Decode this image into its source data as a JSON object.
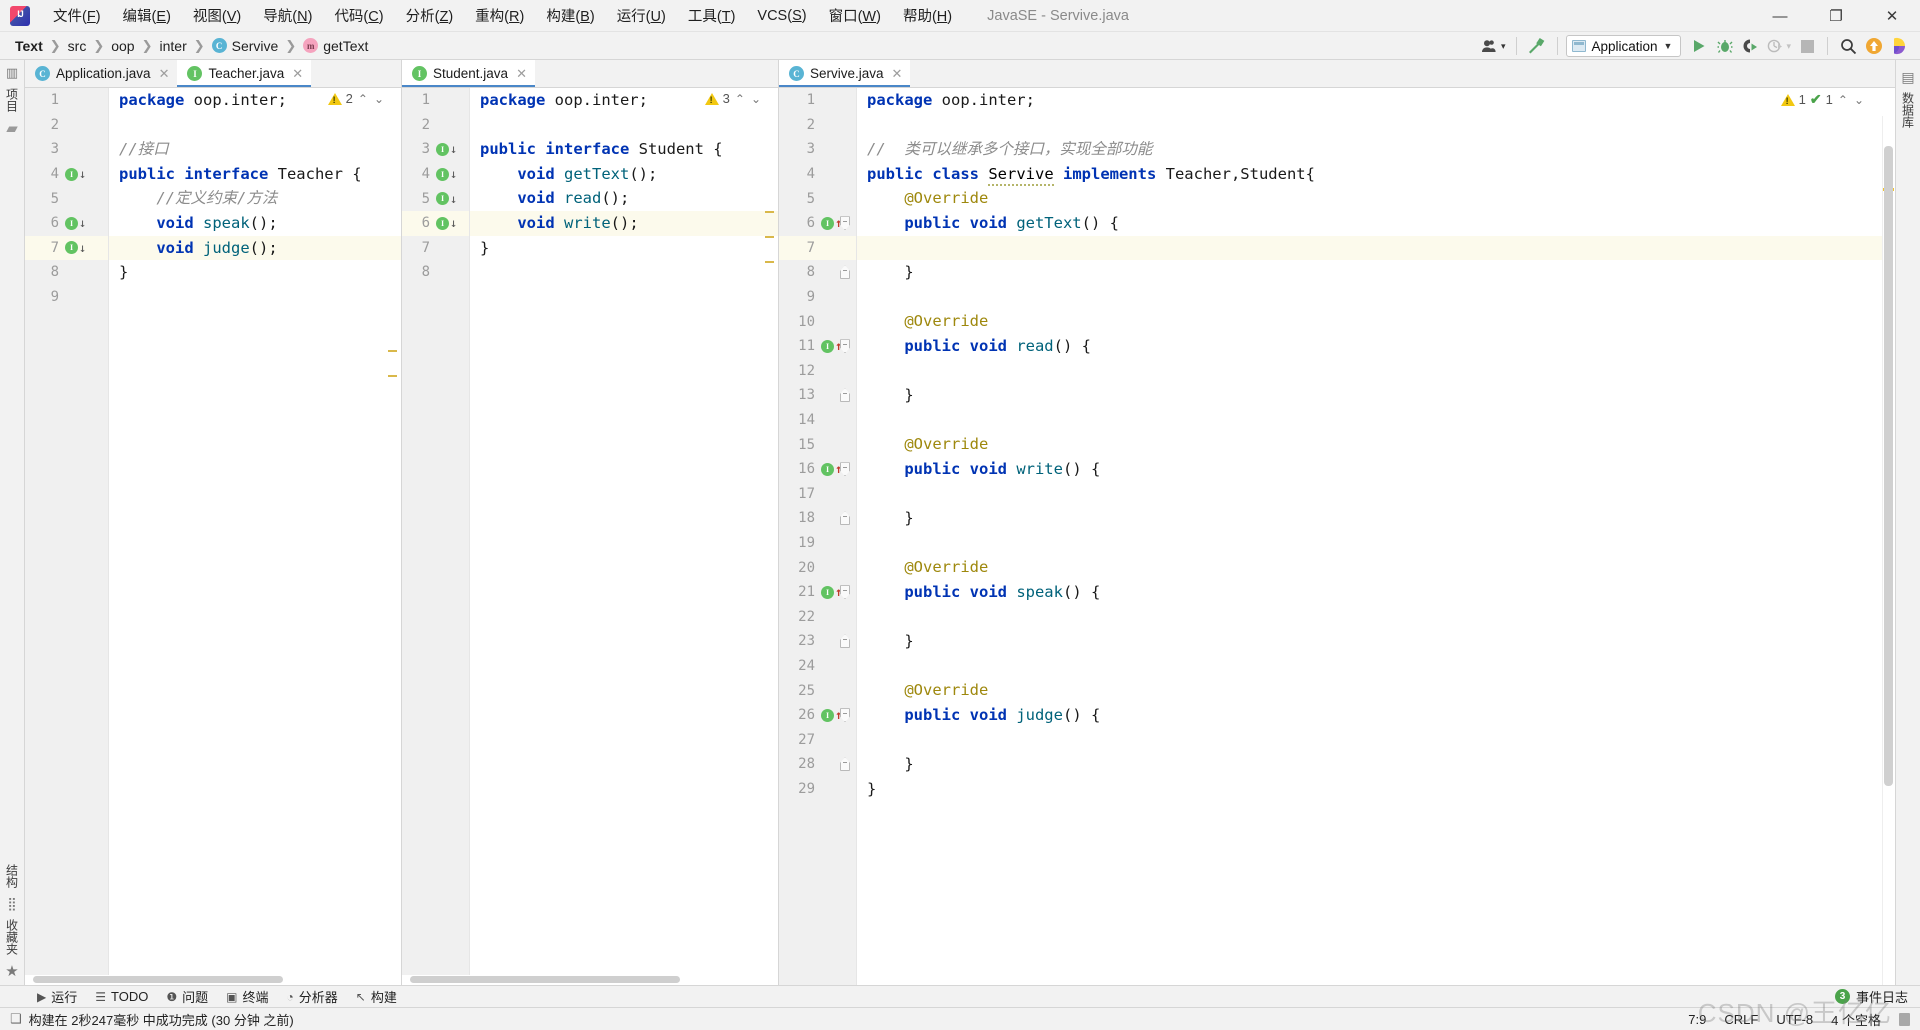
{
  "window": {
    "title": "JavaSE - Servive.java",
    "logo_icon": "intellij-logo-icon",
    "minimize_label": "—",
    "maximize_label": "❐",
    "close_label": "✕"
  },
  "menu": {
    "items": [
      {
        "label": "文件(F)",
        "name": "menu-file"
      },
      {
        "label": "编辑(E)",
        "name": "menu-edit"
      },
      {
        "label": "视图(V)",
        "name": "menu-view"
      },
      {
        "label": "导航(N)",
        "name": "menu-navigate"
      },
      {
        "label": "代码(C)",
        "name": "menu-code"
      },
      {
        "label": "分析(Z)",
        "name": "menu-analyze"
      },
      {
        "label": "重构(R)",
        "name": "menu-refactor"
      },
      {
        "label": "构建(B)",
        "name": "menu-build"
      },
      {
        "label": "运行(U)",
        "name": "menu-run"
      },
      {
        "label": "工具(T)",
        "name": "menu-tools"
      },
      {
        "label": "VCS(S)",
        "name": "menu-vcs"
      },
      {
        "label": "窗口(W)",
        "name": "menu-window"
      },
      {
        "label": "帮助(H)",
        "name": "menu-help"
      }
    ]
  },
  "breadcrumb": {
    "separator": "❯",
    "items": [
      {
        "label": "Text",
        "icon": null,
        "bold": true
      },
      {
        "label": "src",
        "icon": null,
        "bold": false
      },
      {
        "label": "oop",
        "icon": null,
        "bold": false
      },
      {
        "label": "inter",
        "icon": null,
        "bold": false
      },
      {
        "label": "Servive",
        "icon": "class-icon",
        "icon_letter": "C",
        "bold": false
      },
      {
        "label": "getText",
        "icon": "method-icon",
        "icon_letter": "m",
        "bold": false
      }
    ]
  },
  "toolbar": {
    "user_icon": "user-silhouette-icon",
    "build_icon": "hammer-icon",
    "run_config": {
      "label": "Application",
      "icon": "application-window-icon",
      "caret": "▼"
    },
    "run_icon": "run-play-icon",
    "debug_icon": "debug-bug-icon",
    "run_coverage_icon": "run-with-coverage-icon",
    "profile_icon": "profiler-icon",
    "stop_icon": "stop-square-icon",
    "search_icon": "search-magnifier-icon",
    "update_icon": "update-arrow-icon",
    "ide_icon": "ide-feature-icon",
    "caret": "▼"
  },
  "left_strip": {
    "top": [
      {
        "label": "项目",
        "name": "tool-window-project",
        "icon": "project-structure-icon"
      },
      {
        "label": "",
        "name": "tool-window-folder",
        "icon": "folder-icon"
      }
    ],
    "bottom": [
      {
        "label": "结构",
        "name": "tool-window-structure",
        "icon": "structure-blocks-icon"
      },
      {
        "label": "收藏夹",
        "name": "tool-window-favorites",
        "icon": "star-icon"
      }
    ]
  },
  "right_strip": {
    "items": [
      {
        "label": "数据库",
        "name": "tool-window-database",
        "icon": "database-icon"
      }
    ]
  },
  "editor_groups": [
    {
      "name": "editor-pane-1",
      "tabs": [
        {
          "label": "Application.java",
          "icon": "class-run-icon",
          "icon_letter": "C",
          "active": false,
          "close": "✕"
        },
        {
          "label": "Teacher.java",
          "icon": "interface-icon",
          "icon_letter": "I",
          "active": true,
          "close": "✕"
        }
      ],
      "inspection": {
        "warning_icon": "warning-triangle-icon",
        "warning_count": "2",
        "up": "⌃",
        "down": "⌄"
      },
      "lines": [
        {
          "n": "1",
          "marks": [],
          "fold": null,
          "cur": false,
          "tokens": [
            {
              "t": "package ",
              "c": "kw"
            },
            {
              "t": "oop.inter;",
              "c": "plain"
            }
          ]
        },
        {
          "n": "2",
          "marks": [],
          "fold": null,
          "cur": false,
          "tokens": []
        },
        {
          "n": "3",
          "marks": [],
          "fold": null,
          "cur": false,
          "tokens": [
            {
              "t": "//接口",
              "c": "cm"
            }
          ]
        },
        {
          "n": "4",
          "marks": [
            "impl-down"
          ],
          "fold": null,
          "cur": false,
          "tokens": [
            {
              "t": "public interface ",
              "c": "kw"
            },
            {
              "t": "Teacher",
              "c": "plain"
            },
            {
              "t": " {",
              "c": "plain"
            }
          ]
        },
        {
          "n": "5",
          "marks": [],
          "fold": null,
          "cur": false,
          "tokens": [
            {
              "t": "    //定义约束/方法",
              "c": "cm"
            }
          ]
        },
        {
          "n": "6",
          "marks": [
            "impl-down"
          ],
          "fold": null,
          "cur": false,
          "tokens": [
            {
              "t": "    ",
              "c": "plain"
            },
            {
              "t": "void ",
              "c": "kw"
            },
            {
              "t": "speak",
              "c": "mth"
            },
            {
              "t": "();",
              "c": "plain"
            }
          ]
        },
        {
          "n": "7",
          "marks": [
            "impl-down"
          ],
          "fold": null,
          "cur": true,
          "tokens": [
            {
              "t": "    ",
              "c": "plain"
            },
            {
              "t": "void ",
              "c": "kw"
            },
            {
              "t": "judge",
              "c": "mth"
            },
            {
              "t": "();",
              "c": "plain"
            }
          ]
        },
        {
          "n": "8",
          "marks": [],
          "fold": null,
          "cur": false,
          "tokens": [
            {
              "t": "}",
              "c": "plain"
            }
          ]
        },
        {
          "n": "9",
          "marks": [],
          "fold": null,
          "cur": false,
          "tokens": []
        }
      ]
    },
    {
      "name": "editor-pane-2",
      "tabs": [
        {
          "label": "Student.java",
          "icon": "interface-icon",
          "icon_letter": "I",
          "active": true,
          "close": "✕"
        }
      ],
      "inspection": {
        "warning_icon": "warning-triangle-icon",
        "warning_count": "3",
        "up": "⌃",
        "down": "⌄"
      },
      "lines": [
        {
          "n": "1",
          "marks": [],
          "fold": null,
          "cur": false,
          "tokens": [
            {
              "t": "package ",
              "c": "kw"
            },
            {
              "t": "oop.inter;",
              "c": "plain"
            }
          ]
        },
        {
          "n": "2",
          "marks": [],
          "fold": null,
          "cur": false,
          "tokens": []
        },
        {
          "n": "3",
          "marks": [
            "impl-down"
          ],
          "fold": null,
          "cur": false,
          "tokens": [
            {
              "t": "public interface ",
              "c": "kw"
            },
            {
              "t": "Student",
              "c": "plain"
            },
            {
              "t": " {",
              "c": "plain"
            }
          ]
        },
        {
          "n": "4",
          "marks": [
            "impl-down"
          ],
          "fold": null,
          "cur": false,
          "tokens": [
            {
              "t": "    ",
              "c": "plain"
            },
            {
              "t": "void ",
              "c": "kw"
            },
            {
              "t": "getText",
              "c": "mth"
            },
            {
              "t": "();",
              "c": "plain"
            }
          ]
        },
        {
          "n": "5",
          "marks": [
            "impl-down"
          ],
          "fold": null,
          "cur": false,
          "tokens": [
            {
              "t": "    ",
              "c": "plain"
            },
            {
              "t": "void ",
              "c": "kw"
            },
            {
              "t": "read",
              "c": "mth"
            },
            {
              "t": "();",
              "c": "plain"
            }
          ]
        },
        {
          "n": "6",
          "marks": [
            "impl-down"
          ],
          "fold": null,
          "cur": true,
          "tokens": [
            {
              "t": "    ",
              "c": "plain"
            },
            {
              "t": "void ",
              "c": "kw"
            },
            {
              "t": "write",
              "c": "mth"
            },
            {
              "t": "();",
              "c": "plain"
            }
          ]
        },
        {
          "n": "7",
          "marks": [],
          "fold": null,
          "cur": false,
          "tokens": [
            {
              "t": "}",
              "c": "plain"
            }
          ]
        },
        {
          "n": "8",
          "marks": [],
          "fold": null,
          "cur": false,
          "tokens": []
        }
      ]
    },
    {
      "name": "editor-pane-3",
      "tabs": [
        {
          "label": "Servive.java",
          "icon": "class-icon",
          "icon_letter": "C",
          "active": true,
          "close": "✕"
        }
      ],
      "inspection": {
        "warning_icon": "warning-triangle-icon",
        "warning_count": "1",
        "check_icon": "inspection-ok-icon",
        "check_count": "1",
        "up": "⌃",
        "down": "⌄"
      },
      "lines": [
        {
          "n": "1",
          "marks": [],
          "fold": null,
          "cur": false,
          "tokens": [
            {
              "t": "package ",
              "c": "kw"
            },
            {
              "t": "oop.inter;",
              "c": "plain"
            }
          ]
        },
        {
          "n": "2",
          "marks": [],
          "fold": null,
          "cur": false,
          "tokens": []
        },
        {
          "n": "3",
          "marks": [],
          "fold": null,
          "cur": false,
          "tokens": [
            {
              "t": "//  类可以继承多个接口，实现全部功能",
              "c": "cm"
            }
          ]
        },
        {
          "n": "4",
          "marks": [],
          "fold": null,
          "cur": false,
          "tokens": [
            {
              "t": "public class ",
              "c": "kw"
            },
            {
              "t": "Servive",
              "c": "wavy"
            },
            {
              "t": " implements ",
              "c": "kw"
            },
            {
              "t": "Teacher,Student{",
              "c": "plain"
            }
          ]
        },
        {
          "n": "5",
          "marks": [],
          "fold": null,
          "cur": false,
          "tokens": [
            {
              "t": "    @Override",
              "c": "anno"
            }
          ]
        },
        {
          "n": "6",
          "marks": [
            "impl-up"
          ],
          "fold": "open",
          "cur": false,
          "tokens": [
            {
              "t": "    ",
              "c": "plain"
            },
            {
              "t": "public void ",
              "c": "kw"
            },
            {
              "t": "getText",
              "c": "mth"
            },
            {
              "t": "() {",
              "c": "plain"
            }
          ]
        },
        {
          "n": "7",
          "marks": [],
          "fold": null,
          "cur": true,
          "tokens": []
        },
        {
          "n": "8",
          "marks": [],
          "fold": "end",
          "cur": false,
          "tokens": [
            {
              "t": "    }",
              "c": "plain"
            }
          ]
        },
        {
          "n": "9",
          "marks": [],
          "fold": null,
          "cur": false,
          "tokens": []
        },
        {
          "n": "10",
          "marks": [],
          "fold": null,
          "cur": false,
          "tokens": [
            {
              "t": "    @Override",
              "c": "anno"
            }
          ]
        },
        {
          "n": "11",
          "marks": [
            "impl-up"
          ],
          "fold": "open",
          "cur": false,
          "tokens": [
            {
              "t": "    ",
              "c": "plain"
            },
            {
              "t": "public void ",
              "c": "kw"
            },
            {
              "t": "read",
              "c": "mth"
            },
            {
              "t": "() {",
              "c": "plain"
            }
          ]
        },
        {
          "n": "12",
          "marks": [],
          "fold": null,
          "cur": false,
          "tokens": []
        },
        {
          "n": "13",
          "marks": [],
          "fold": "end",
          "cur": false,
          "tokens": [
            {
              "t": "    }",
              "c": "plain"
            }
          ]
        },
        {
          "n": "14",
          "marks": [],
          "fold": null,
          "cur": false,
          "tokens": []
        },
        {
          "n": "15",
          "marks": [],
          "fold": null,
          "cur": false,
          "tokens": [
            {
              "t": "    @Override",
              "c": "anno"
            }
          ]
        },
        {
          "n": "16",
          "marks": [
            "impl-up"
          ],
          "fold": "open",
          "cur": false,
          "tokens": [
            {
              "t": "    ",
              "c": "plain"
            },
            {
              "t": "public void ",
              "c": "kw"
            },
            {
              "t": "write",
              "c": "mth"
            },
            {
              "t": "() {",
              "c": "plain"
            }
          ]
        },
        {
          "n": "17",
          "marks": [],
          "fold": null,
          "cur": false,
          "tokens": []
        },
        {
          "n": "18",
          "marks": [],
          "fold": "end",
          "cur": false,
          "tokens": [
            {
              "t": "    }",
              "c": "plain"
            }
          ]
        },
        {
          "n": "19",
          "marks": [],
          "fold": null,
          "cur": false,
          "tokens": []
        },
        {
          "n": "20",
          "marks": [],
          "fold": null,
          "cur": false,
          "tokens": [
            {
              "t": "    @Override",
              "c": "anno"
            }
          ]
        },
        {
          "n": "21",
          "marks": [
            "impl-up"
          ],
          "fold": "open",
          "cur": false,
          "tokens": [
            {
              "t": "    ",
              "c": "plain"
            },
            {
              "t": "public void ",
              "c": "kw"
            },
            {
              "t": "speak",
              "c": "mth"
            },
            {
              "t": "() {",
              "c": "plain"
            }
          ]
        },
        {
          "n": "22",
          "marks": [],
          "fold": null,
          "cur": false,
          "tokens": []
        },
        {
          "n": "23",
          "marks": [],
          "fold": "end",
          "cur": false,
          "tokens": [
            {
              "t": "    }",
              "c": "plain"
            }
          ]
        },
        {
          "n": "24",
          "marks": [],
          "fold": null,
          "cur": false,
          "tokens": []
        },
        {
          "n": "25",
          "marks": [],
          "fold": null,
          "cur": false,
          "tokens": [
            {
              "t": "    @Override",
              "c": "anno"
            }
          ]
        },
        {
          "n": "26",
          "marks": [
            "impl-up"
          ],
          "fold": "open",
          "cur": false,
          "tokens": [
            {
              "t": "    ",
              "c": "plain"
            },
            {
              "t": "public void ",
              "c": "kw"
            },
            {
              "t": "judge",
              "c": "mth"
            },
            {
              "t": "() {",
              "c": "plain"
            }
          ]
        },
        {
          "n": "27",
          "marks": [],
          "fold": null,
          "cur": false,
          "tokens": []
        },
        {
          "n": "28",
          "marks": [],
          "fold": "end",
          "cur": false,
          "tokens": [
            {
              "t": "    }",
              "c": "plain"
            }
          ]
        },
        {
          "n": "29",
          "marks": [],
          "fold": null,
          "cur": false,
          "tokens": [
            {
              "t": "}",
              "c": "plain"
            }
          ]
        }
      ]
    }
  ],
  "tool_window_bar": {
    "items": [
      {
        "label": "运行",
        "icon": "run-play-icon",
        "glyph": "▶",
        "name": "tool-window-run"
      },
      {
        "label": "TODO",
        "icon": "todo-list-icon",
        "glyph": "☰",
        "name": "tool-window-todo"
      },
      {
        "label": "问题",
        "icon": "problems-icon",
        "glyph": "❶",
        "name": "tool-window-problems"
      },
      {
        "label": "终端",
        "icon": "terminal-icon",
        "glyph": "▣",
        "name": "tool-window-terminal"
      },
      {
        "label": "分析器",
        "icon": "profiler-icon",
        "glyph": "◔",
        "name": "tool-window-profiler"
      },
      {
        "label": "构建",
        "icon": "hammer-icon",
        "glyph": "↖",
        "name": "tool-window-build"
      }
    ],
    "event_log": {
      "label": "事件日志",
      "count": "3",
      "name": "event-log-button"
    }
  },
  "status_bar": {
    "message": "构建在 2秒247毫秒 中成功完成 (30 分钟 之前)",
    "message_icon": "build-status-icon",
    "caret_position": "7:9",
    "line_separator": "CRLF",
    "encoding": "UTF-8",
    "indent": "4 个空格",
    "lock_icon": "read-only-lock-icon"
  },
  "watermark": "CSDN @王亿亿"
}
